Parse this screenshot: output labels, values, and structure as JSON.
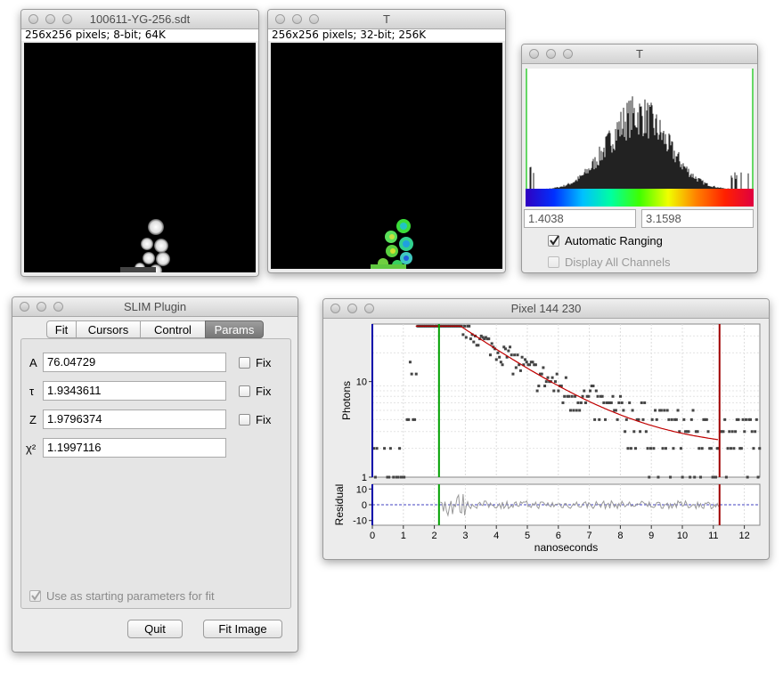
{
  "win1": {
    "title": "100611-YG-256.sdt",
    "info": "256x256 pixels; 8-bit; 64K"
  },
  "win2": {
    "title": "T",
    "info": "256x256 pixels; 32-bit; 256K"
  },
  "hist": {
    "title": "T",
    "min": "1.4038",
    "max": "3.1598",
    "auto_ranging": "Automatic Ranging",
    "auto_ranging_checked": true,
    "display_all": "Display All Channels",
    "display_all_checked": false
  },
  "slim": {
    "title": "SLIM Plugin",
    "tabs": [
      "Fit",
      "Cursors",
      "Control",
      "Params"
    ],
    "active_tab": "Params",
    "params": [
      {
        "label": "A",
        "value": "76.04729",
        "fix": "Fix"
      },
      {
        "label": "τ",
        "value": "1.9343611",
        "fix": "Fix"
      },
      {
        "label": "Z",
        "value": "1.9796374",
        "fix": "Fix"
      },
      {
        "label": "χ²",
        "value": "1.1997116"
      }
    ],
    "use_start": "Use as starting parameters for fit",
    "quit": "Quit",
    "fit_image": "Fit Image"
  },
  "pixel": {
    "title": "Pixel 144 230",
    "colors": {
      "fit": "#c00000",
      "data": "#444444",
      "residual": "#999999",
      "start_cursor": "#0000aa",
      "fit_start": "#00a000",
      "fit_end": "#a00000"
    }
  },
  "chart_data": {
    "type": "scatter",
    "title": "",
    "xlabel": "nanoseconds",
    "ylabel": "Photons",
    "xlim": [
      0,
      12.5
    ],
    "ylim": [
      1,
      40
    ],
    "y_log": true,
    "x_ticks": [
      "0",
      "1",
      "2",
      "3",
      "4",
      "5",
      "6",
      "7",
      "8",
      "9",
      "10",
      "11",
      "12"
    ],
    "y_ticks": [
      "1",
      "10"
    ],
    "residual_ylabel": "Residual",
    "residual_ticks": [
      "10",
      "0",
      "-10"
    ],
    "residual_ylim": [
      -13,
      13
    ],
    "cursors": {
      "start": 0.0,
      "fit_start": 2.15,
      "fit_end": 11.2
    },
    "fit": {
      "A": 76.04729,
      "tau": 1.9343611,
      "Z": 1.9796374,
      "x_start": 1.4,
      "x_end": 11.2
    }
  }
}
